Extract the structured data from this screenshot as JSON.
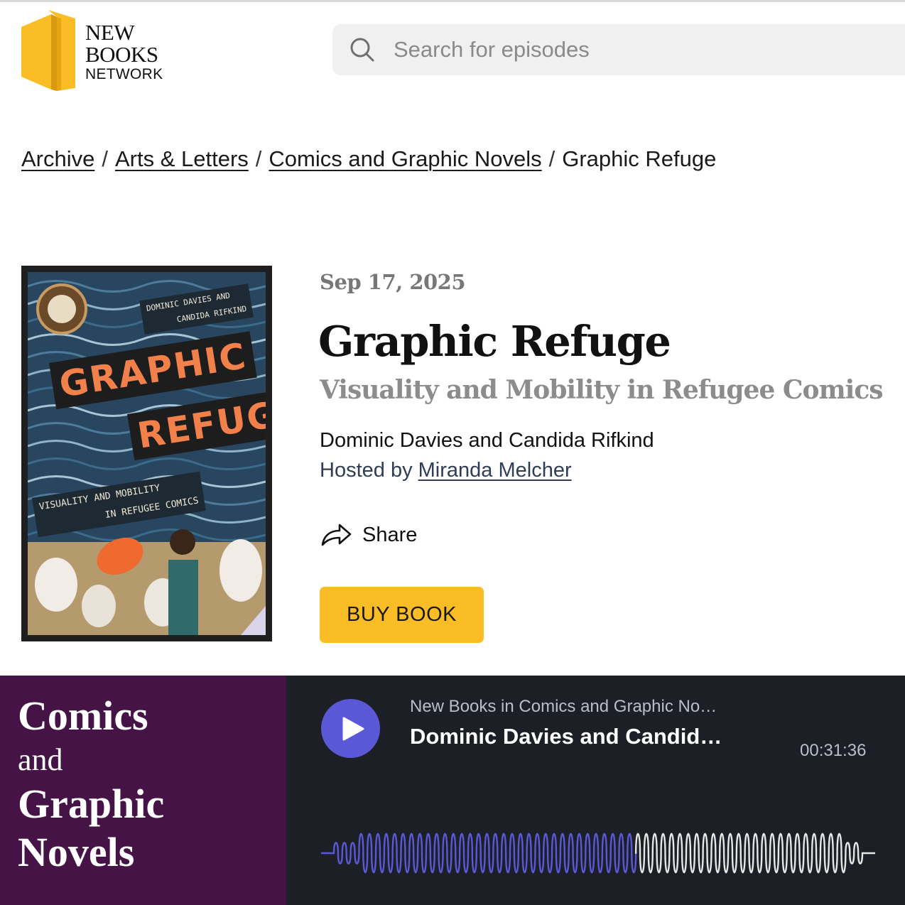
{
  "header": {
    "logo": {
      "line1": "NEW",
      "line2": "BOOKS",
      "line3": "NETWORK",
      "brand_color": "#fbbd26"
    },
    "search": {
      "placeholder": "Search for episodes",
      "icon": "search-icon"
    }
  },
  "breadcrumb": {
    "items": [
      "Archive",
      "Arts & Letters",
      "Comics and Graphic Novels",
      "Graphic Refuge"
    ],
    "separator": "/"
  },
  "episode": {
    "date": "Sep 17, 2025",
    "title": "Graphic Refuge",
    "subtitle": "Visuality and Mobility in Refugee Comics",
    "authors": "Dominic Davies and Candida Rifkind",
    "hosted_prefix": "Hosted by",
    "host": "Miranda Melcher",
    "share_label": "Share",
    "buy_label": "BUY BOOK",
    "cover": {
      "title_line1": "GRAPHIC",
      "title_line2": "REFUGE",
      "authors_line1": "DOMINIC DAVIES AND",
      "authors_line2": "CANDIDA RIFKIND",
      "subtitle_line1": "VISUALITY AND MOBILITY",
      "subtitle_line2": "IN REFUGEE COMICS"
    }
  },
  "player": {
    "podcast_art": {
      "line1": "Comics",
      "line2": "and",
      "line3": "Graphic",
      "line4": "Novels",
      "color": "#461346"
    },
    "show_name": "New Books in Comics and Graphic No…",
    "episode_name": "Dominic Davies and Candid…",
    "duration": "00:31:36",
    "progress": 0.57,
    "accent": "#5a58d6",
    "background": "#1c1f25"
  }
}
